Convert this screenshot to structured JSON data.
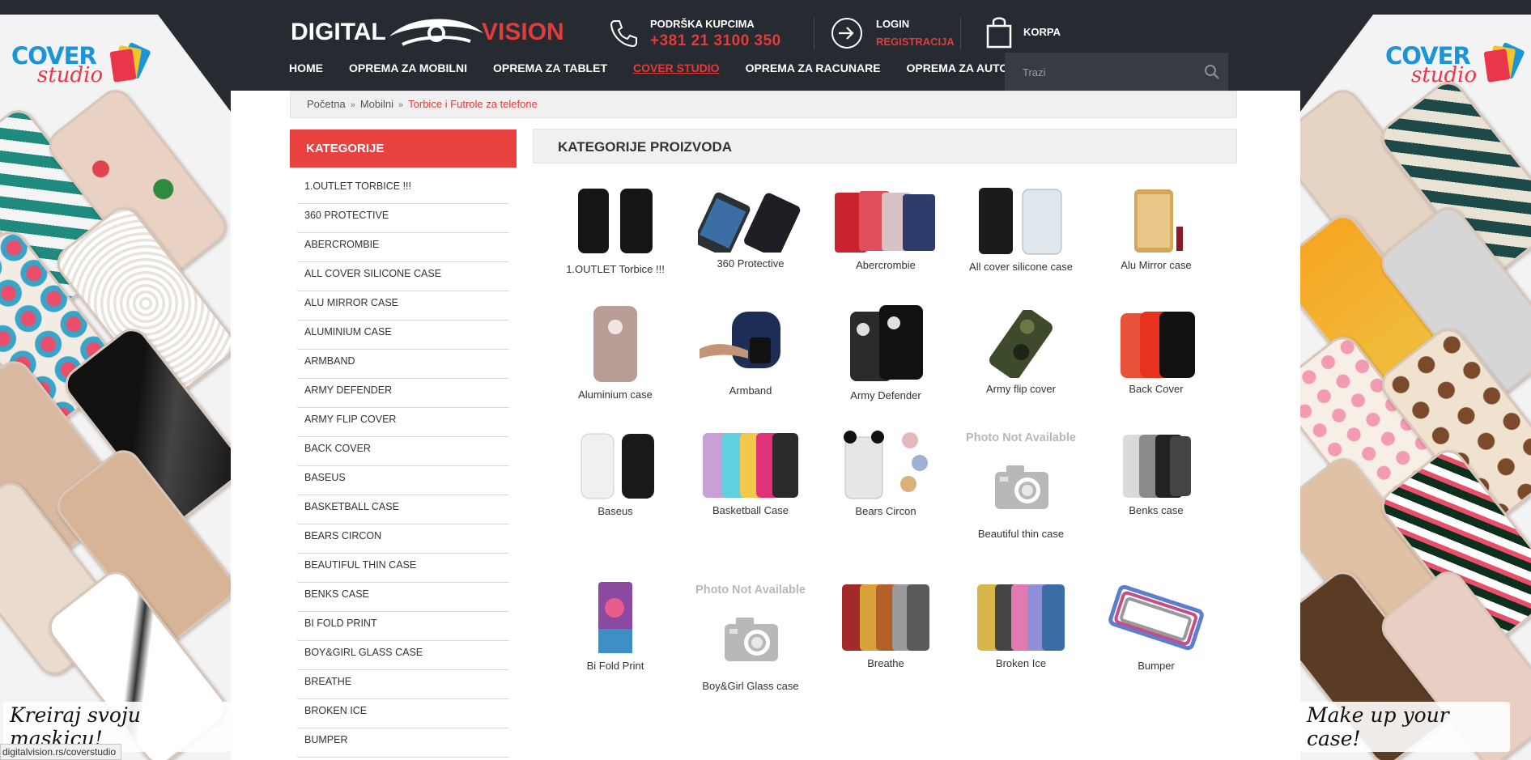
{
  "brand": {
    "logo_left": "DIGITAL",
    "logo_right": "VISION",
    "cover_logo_line1": "COVER",
    "cover_logo_line2": "studio"
  },
  "header": {
    "support_label": "PODRŠKA KUPCIMA",
    "support_phone": "+381 21 3100 350",
    "login_label": "LOGIN",
    "register_label": "REGISTRACIJA",
    "cart_label": "KORPA"
  },
  "nav": {
    "items": [
      "HOME",
      "OPREMA ZA MOBILNI",
      "OPREMA ZA TABLET",
      "COVER STUDIO",
      "OPREMA ZA RACUNARE",
      "OPREMA ZA AUTO"
    ],
    "active": "COVER STUDIO"
  },
  "search": {
    "placeholder": "Trazi"
  },
  "breadcrumb": {
    "items": [
      "Početna",
      "Mobilni"
    ],
    "current": "Torbice i Futrole za telefone"
  },
  "sidebar": {
    "title": "KATEGORIJE",
    "items": [
      "1.OUTLET TORBICE !!!",
      "360 PROTECTIVE",
      "ABERCROMBIE",
      "ALL COVER SILICONE CASE",
      "ALU MIRROR CASE",
      "ALUMINIUM CASE",
      "ARMBAND",
      "ARMY DEFENDER",
      "ARMY FLIP COVER",
      "BACK COVER",
      "BASEUS",
      "BASKETBALL CASE",
      "BEARS CIRCON",
      "BEAUTIFUL THIN CASE",
      "BENKS CASE",
      "BI FOLD PRINT",
      "BOY&GIRL GLASS CASE",
      "BREATHE",
      "BROKEN ICE",
      "BUMPER"
    ]
  },
  "main": {
    "title": "KATEGORIJE PROIZVODA",
    "no_photo_text": "Photo Not Available",
    "products": [
      "1.OUTLET Torbice !!!",
      "360 Protective",
      "Abercrombie",
      "All cover silicone case",
      "Alu Mirror case",
      "Aluminium case",
      "Armband",
      "Army Defender",
      "Army flip cover",
      "Back Cover",
      "Baseus",
      "Basketball Case",
      "Bears Circon",
      "Beautiful thin case",
      "Benks case",
      "Bi Fold Print",
      "Boy&Girl Glass case",
      "Breathe",
      "Broken Ice",
      "Bumper"
    ]
  },
  "banners": {
    "left_slogan": "Kreiraj svoju maskicu!",
    "right_slogan": "Make up your case!"
  },
  "status_url": "digitalvision.rs/coverstudio",
  "colors": {
    "accent": "#e8413f",
    "header_bg": "#262a31",
    "link_red": "#e33a3a"
  }
}
